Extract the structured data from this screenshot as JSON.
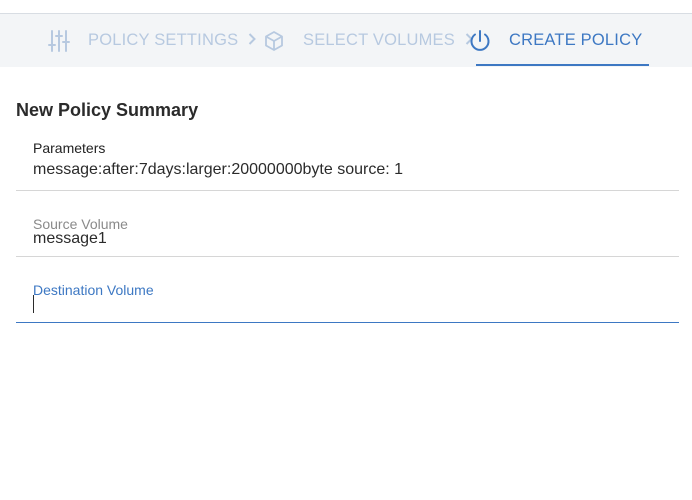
{
  "stepper": {
    "steps": [
      {
        "label": "POLICY SETTINGS",
        "icon": "sliders-icon",
        "state": "completed"
      },
      {
        "label": "SELECT VOLUMES",
        "icon": "cube-icon",
        "state": "completed"
      },
      {
        "label": "CREATE POLICY",
        "icon": "power-icon",
        "state": "active"
      }
    ],
    "separator_icon": "chevron-right-icon"
  },
  "summary": {
    "title": "New Policy Summary",
    "parameters": {
      "label": "Parameters",
      "value": "message:after:7days:larger:20000000byte source: 1"
    },
    "source_volume": {
      "label": "Source Volume",
      "value": "message1"
    },
    "destination_volume": {
      "label": "Destination Volume",
      "value": ""
    }
  },
  "colors": {
    "accent": "#3d78c3",
    "inactive_step": "#b7c9e0",
    "stepper_bg": "#f3f5f7",
    "divider": "#d6d6d6"
  }
}
